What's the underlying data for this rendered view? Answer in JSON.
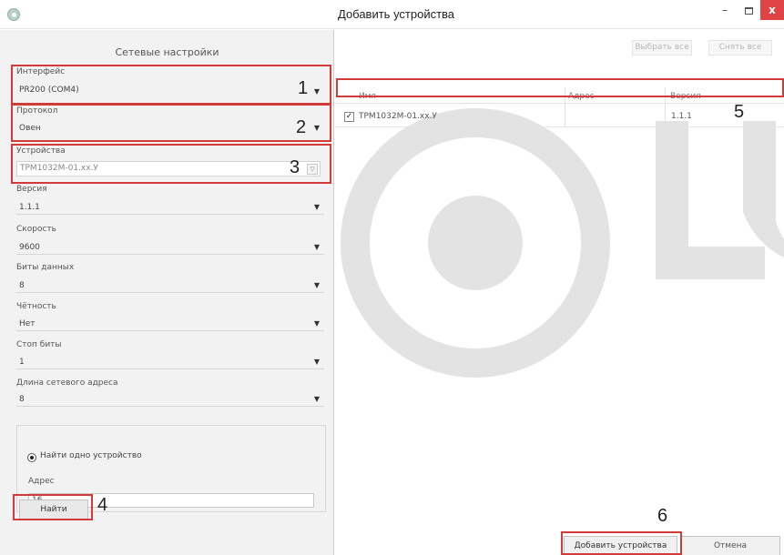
{
  "window": {
    "title": "Добавить устройства",
    "minimize_glyph": "–",
    "close_glyph": "x"
  },
  "left": {
    "title": "Сетевые настройки",
    "interface": {
      "label": "Интерфейс",
      "value": "PR200 (COM4)"
    },
    "protocol": {
      "label": "Протокол",
      "value": "Овен"
    },
    "devices": {
      "label": "Устройства",
      "value": "ТРМ1032М-01.хх.У"
    },
    "version": {
      "label": "Версия",
      "value": "1.1.1"
    },
    "speed": {
      "label": "Скорость",
      "value": "9600"
    },
    "data_bits": {
      "label": "Биты данных",
      "value": "8"
    },
    "parity": {
      "label": "Чётность",
      "value": "Нет"
    },
    "stop_bits": {
      "label": "Стоп биты",
      "value": "1"
    },
    "addr_length": {
      "label": "Длина сетевого адреса",
      "value": "8"
    },
    "find_one": {
      "label": "Найти одно устройство",
      "selected": true
    },
    "address": {
      "label": "Адрес",
      "value": "16"
    },
    "find_button": "Найти"
  },
  "right": {
    "select_all": "Выбрать все",
    "deselect_all": "Снять все",
    "columns": [
      "Имя",
      "Адрес",
      "Версия"
    ],
    "rows": [
      {
        "checked": "✓",
        "name": "ТРМ1032М-01.хх.У",
        "address": "",
        "version": "1.1.1"
      }
    ],
    "add_button": "Добавить устройства",
    "cancel_button": "Отмена"
  },
  "callouts": [
    "1",
    "2",
    "3",
    "4",
    "5",
    "6"
  ],
  "icons": {
    "dropdown": "▼",
    "dropdown_small": "▽"
  },
  "colors": {
    "highlight_frame": "#d33a3a",
    "close_button": "#e04343",
    "watermark": "#e3e3e3"
  }
}
